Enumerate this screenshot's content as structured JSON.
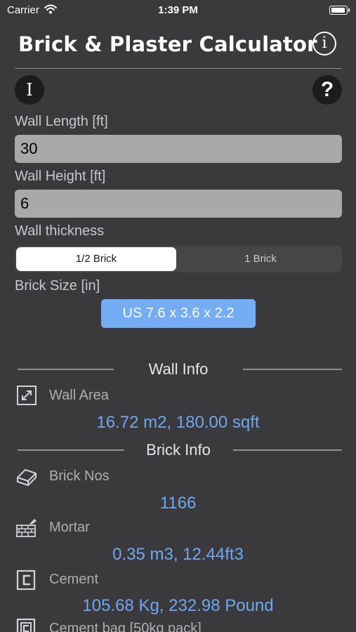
{
  "status_bar": {
    "carrier": "Carrier",
    "time": "1:39 PM"
  },
  "header": {
    "title": "Brick & Plaster Calculator",
    "info_glyph": "i"
  },
  "toolbar": {
    "text_mode_glyph": "I",
    "help_glyph": "?"
  },
  "form": {
    "wall_length_label": "Wall Length [ft]",
    "wall_length_value": "30",
    "wall_height_label": "Wall Height [ft]",
    "wall_height_value": "6",
    "thickness_label": "Wall thickness",
    "thickness_options": [
      "1/2 Brick",
      "1 Brick"
    ],
    "thickness_selected": "1/2 Brick",
    "brick_size_label": "Brick Size [in]",
    "brick_size_value": "US 7.6 x 3.6 x 2.2"
  },
  "wall_info": {
    "title": "Wall Info",
    "wall_area_label": "Wall Area",
    "wall_area_value": "16.72 m2, 180.00 sqft"
  },
  "brick_info": {
    "title": "Brick Info",
    "brick_nos_label": "Brick Nos",
    "brick_nos_value": "1166",
    "mortar_label": "Mortar",
    "mortar_value": "0.35 m3, 12.44ft3",
    "cement_label": "Cement",
    "cement_value": "105.68 Kg, 232.98 Pound",
    "cement_bag_label": "Cement bag [50kg pack]"
  },
  "colors": {
    "background": "#3a3a3c",
    "accent_value": "#6fa8f0",
    "button_blue": "#75adf5",
    "field_bg": "#a9a9a9"
  },
  "icons": [
    "wifi-icon",
    "battery-icon",
    "info-icon",
    "text-cursor-icon",
    "help-icon",
    "expand-arrows-icon",
    "brick-icon",
    "brick-wall-trowel-icon",
    "cement-icon",
    "cement-bag-icon"
  ]
}
